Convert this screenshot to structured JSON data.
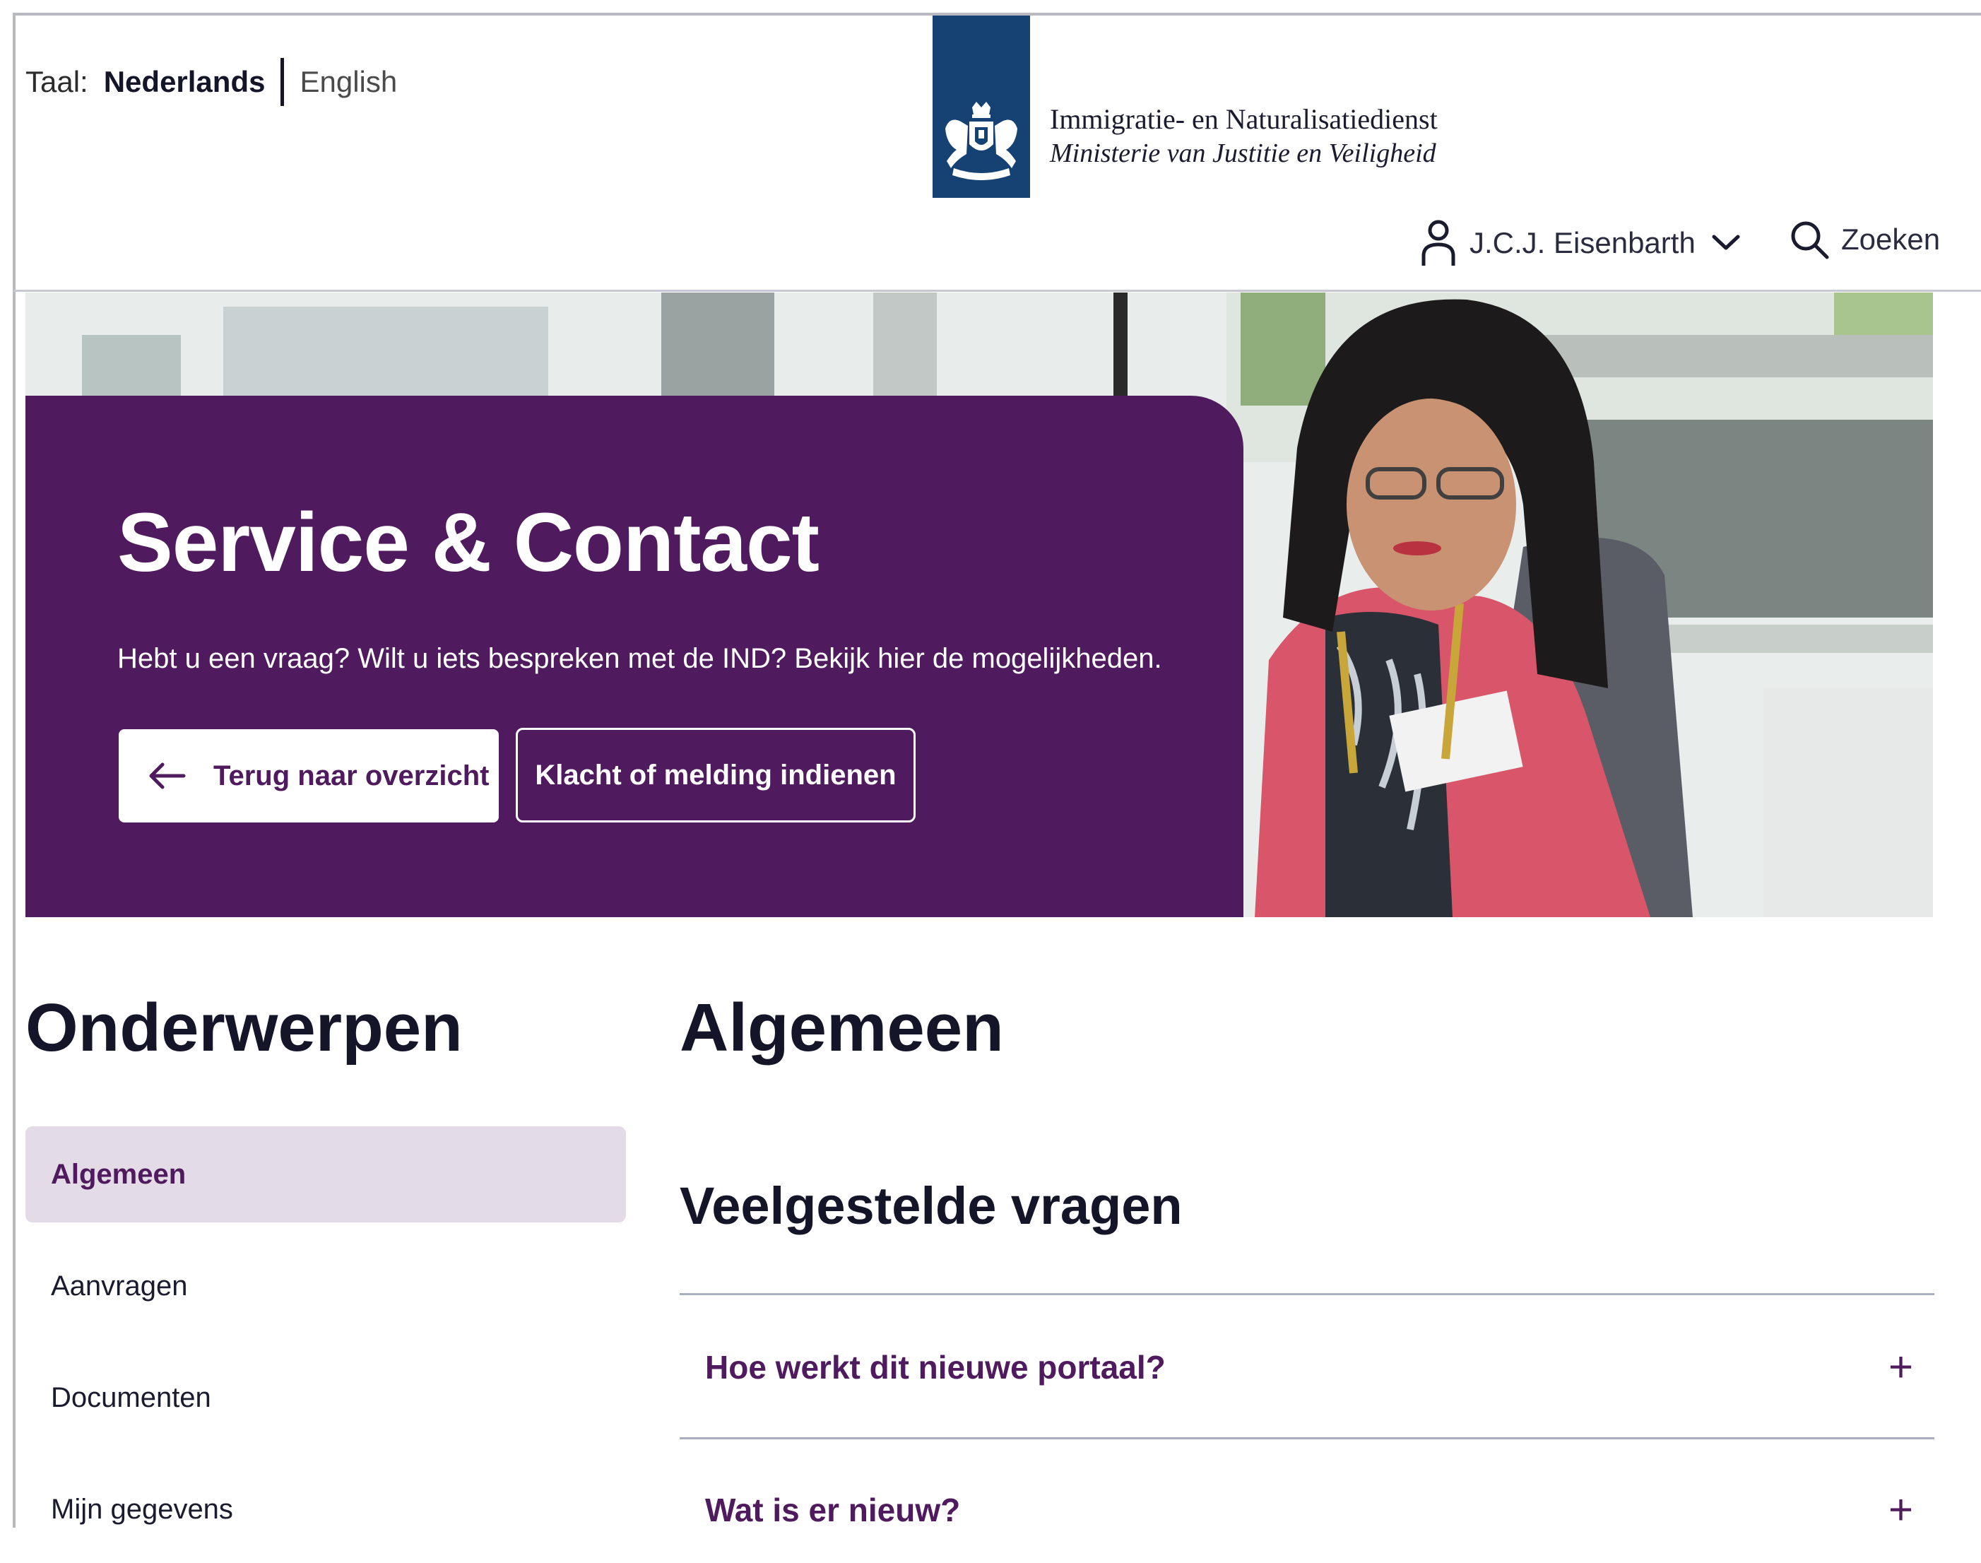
{
  "header": {
    "language": {
      "label": "Taal:",
      "active": "Nederlands",
      "other": "English"
    },
    "logo": {
      "line1": "Immigratie- en Naturalisatiedienst",
      "line2": "Ministerie van Justitie en Veiligheid"
    },
    "user": {
      "name": "J.C.J. Eisenbarth"
    },
    "search": {
      "label": "Zoeken"
    }
  },
  "hero": {
    "title": "Service & Contact",
    "subtitle": "Hebt u een vraag? Wilt u iets bespreken met de IND? Bekijk hier de mogelijkheden.",
    "back_button": "Terug naar overzicht",
    "complaint_button": "Klacht of melding indienen"
  },
  "sidebar": {
    "title": "Onderwerpen",
    "items": [
      {
        "label": "Algemeen",
        "active": true
      },
      {
        "label": "Aanvragen",
        "active": false
      },
      {
        "label": "Documenten",
        "active": false
      },
      {
        "label": "Mijn gegevens",
        "active": false
      }
    ]
  },
  "main": {
    "title": "Algemeen",
    "faq_title": "Veelgestelde vragen",
    "faq": [
      {
        "question": "Hoe werkt dit nieuwe portaal?"
      },
      {
        "question": "Wat is er nieuw?"
      }
    ]
  },
  "colors": {
    "brand_purple": "#4f1b5e",
    "logo_blue": "#154273",
    "active_nav_bg": "#e3dbe6"
  },
  "icons": [
    "user-icon",
    "chevron-down-icon",
    "search-icon",
    "arrow-left-icon",
    "plus-icon",
    "coat-of-arms-icon"
  ]
}
